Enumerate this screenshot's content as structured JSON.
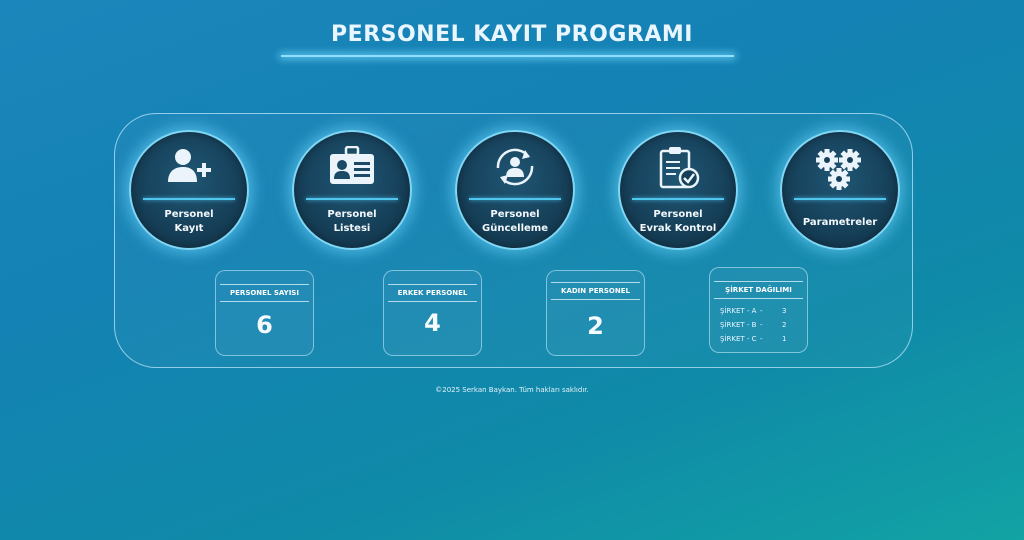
{
  "header": {
    "title": "PERSONEL KAYIT PROGRAMI"
  },
  "menu": [
    {
      "line1": "Personel",
      "line2": "Kayıt",
      "icon": "user-add-icon"
    },
    {
      "line1": "Personel",
      "line2": "Listesi",
      "icon": "id-card-icon"
    },
    {
      "line1": "Personel",
      "line2": "Güncelleme",
      "icon": "user-refresh-icon"
    },
    {
      "line1": "Personel",
      "line2": "Evrak Kontrol",
      "icon": "clipboard-check-icon"
    },
    {
      "line1": "Parametreler",
      "icon": "gears-icon"
    }
  ],
  "stats": {
    "total": {
      "label": "PERSONEL SAYISI",
      "value": "6"
    },
    "male": {
      "label": "ERKEK PERSONEL",
      "value": "4"
    },
    "female": {
      "label": "KADIN PERSONEL",
      "value": "2"
    },
    "distribution": {
      "label": "ŞİRKET DAĞILIMI",
      "rows": [
        {
          "name": "ŞİRKET - A",
          "dash": "-",
          "value": "3"
        },
        {
          "name": "ŞİRKET - B",
          "dash": "-",
          "value": "2"
        },
        {
          "name": "ŞİRKET - C",
          "dash": "-",
          "value": "1"
        }
      ]
    }
  },
  "footer": {
    "text": "©2025 Serkan Baykan. Tüm hakları saklıdır."
  }
}
